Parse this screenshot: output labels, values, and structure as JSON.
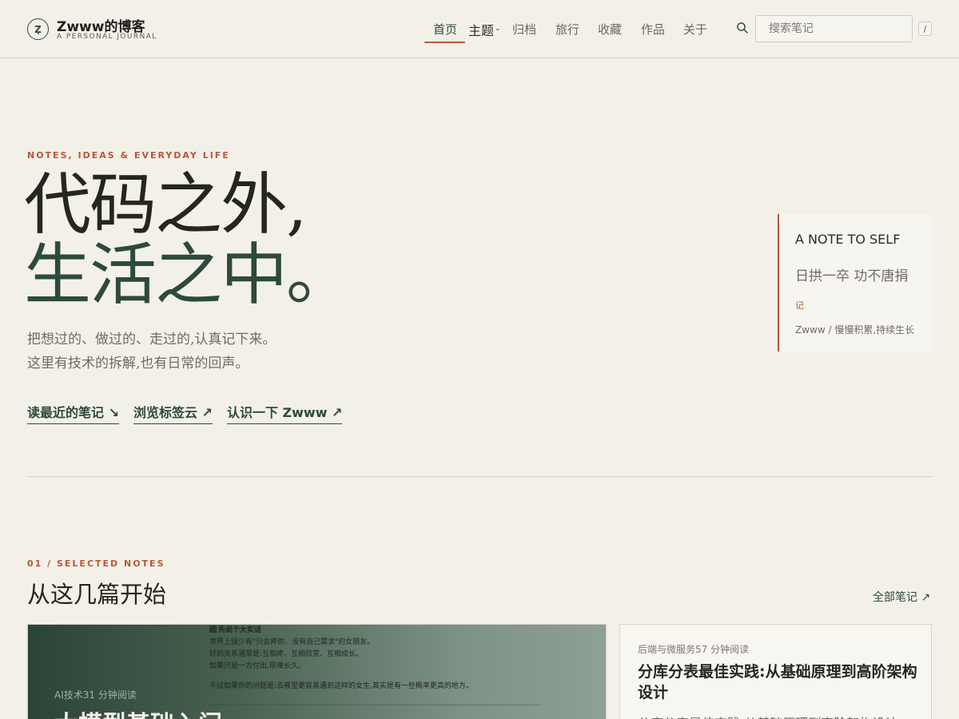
{
  "site": {
    "title": "Zwww的博客",
    "subtitle": "A PERSONAL JOURNAL",
    "logo_letter": "Z"
  },
  "nav": {
    "items": [
      {
        "label": "首页",
        "active": true
      },
      {
        "label": "主题",
        "has_dropdown": true
      },
      {
        "label": "归档"
      },
      {
        "label": "旅行"
      },
      {
        "label": "收藏"
      },
      {
        "label": "作品"
      },
      {
        "label": "关于"
      }
    ],
    "search_placeholder": "搜索笔记",
    "search_shortcut": "/",
    "accent": "#b7573b"
  },
  "hero": {
    "eyebrow": "NOTES, IDEAS & EVERYDAY LIFE",
    "line1": "代码之外,",
    "line2": "生活之中。",
    "desc1": "把想过的、做过的、走过的,认真记下来。",
    "desc2": "这里有技术的拆解,也有日常的回声。",
    "links": [
      "读最近的笔记 ↘",
      "浏览标签云 ↗",
      "认识一下 Zwww ↗"
    ]
  },
  "note": {
    "title": "A NOTE TO SELF",
    "quote": "日拱一卒 功不唐捐",
    "tag": "记",
    "signature": "Zwww / 慢慢积累,持续生长"
  },
  "selected": {
    "eyebrow": "01 / SELECTED NOTES",
    "title": "从这几篇开始",
    "all_link": "全部笔记 ↗",
    "feature": {
      "meta": "AI技术31 分钟阅读",
      "title": "大模型基础入门",
      "shot_lines": [
        "先说个大实话",
        "世界上很少有\"只会疼你、没有自己需求\"的女朋友。",
        "好的关系通常是:互相疼、互相欣赏、互相成长。",
        "如果只是一方付出,很难长久。",
        "不过如果你的问题是:去哪里更容易遇到这样的女生,其实是有一些概率更高的地方。"
      ]
    },
    "side": {
      "meta": "后端与微服务57 分钟阅读",
      "title": "分库分表最佳实践:从基础原理到高阶架构设计",
      "excerpt": "分库分表最佳实践:从基础原理到高阶架构设计"
    }
  }
}
